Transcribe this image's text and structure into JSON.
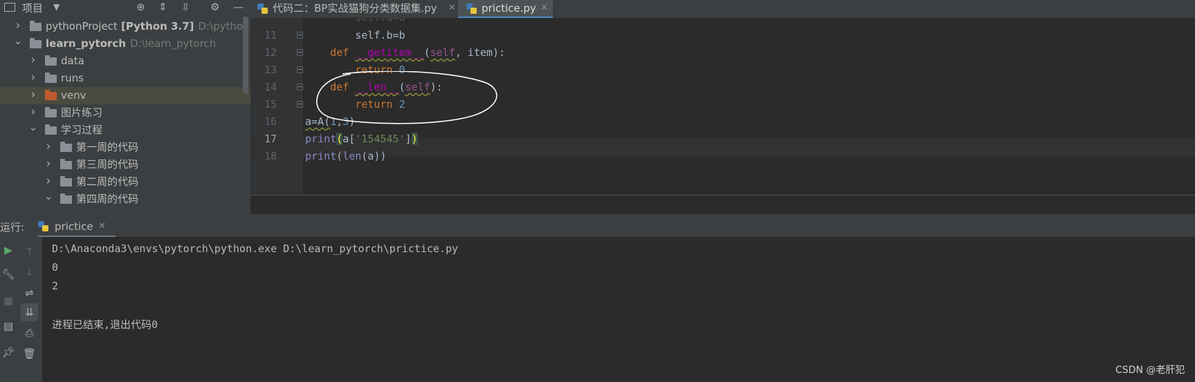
{
  "project_panel": {
    "title": "项目",
    "tree": [
      {
        "label": "pythonProject",
        "suffix": "[Python 3.7]",
        "path": "D:\\pythonProje",
        "depth": 0,
        "expanded": false,
        "bold": false
      },
      {
        "label": "learn_pytorch",
        "suffix": "",
        "path": "D:\\learn_pytorch",
        "depth": 0,
        "expanded": true,
        "bold": true
      },
      {
        "label": "data",
        "suffix": "",
        "path": "",
        "depth": 1,
        "expanded": false,
        "bold": false
      },
      {
        "label": "runs",
        "suffix": "",
        "path": "",
        "depth": 1,
        "expanded": false,
        "bold": false
      },
      {
        "label": "venv",
        "suffix": "",
        "path": "",
        "depth": 1,
        "expanded": false,
        "bold": false,
        "selected": true,
        "color": "orange"
      },
      {
        "label": "图片练习",
        "suffix": "",
        "path": "",
        "depth": 1,
        "expanded": false,
        "bold": false
      },
      {
        "label": "学习过程",
        "suffix": "",
        "path": "",
        "depth": 1,
        "expanded": true,
        "bold": false
      },
      {
        "label": "第一周的代码",
        "suffix": "",
        "path": "",
        "depth": 2,
        "expanded": false,
        "bold": false
      },
      {
        "label": "第三周的代码",
        "suffix": "",
        "path": "",
        "depth": 2,
        "expanded": false,
        "bold": false
      },
      {
        "label": "第二周的代码",
        "suffix": "",
        "path": "",
        "depth": 2,
        "expanded": false,
        "bold": false
      },
      {
        "label": "第四周的代码",
        "suffix": "",
        "path": "",
        "depth": 2,
        "expanded": true,
        "bold": false
      }
    ]
  },
  "editor": {
    "tabs": [
      {
        "label": "代码二：BP实战猫狗分类数据集.py",
        "active": false
      },
      {
        "label": "prictice.py",
        "active": true
      }
    ],
    "lines": [
      {
        "num": "11",
        "tokens": [
          [
            "plain",
            "        self.b"
          ],
          [
            "plain",
            "="
          ],
          [
            "plain",
            "b"
          ]
        ]
      },
      {
        "num": "12",
        "tokens": [
          [
            "plain",
            "    "
          ],
          [
            "kw",
            "def "
          ],
          [
            "fn-magic",
            "__getitem__"
          ],
          [
            "plain",
            "("
          ],
          [
            "self",
            "self"
          ],
          [
            "plain",
            ", item):"
          ]
        ]
      },
      {
        "num": "13",
        "tokens": [
          [
            "plain",
            "        "
          ],
          [
            "kw",
            "return "
          ],
          [
            "num",
            "0"
          ]
        ]
      },
      {
        "num": "14",
        "tokens": [
          [
            "plain",
            "    "
          ],
          [
            "kw",
            "def "
          ],
          [
            "fn-magic",
            "__len__"
          ],
          [
            "plain",
            "("
          ],
          [
            "self",
            "self"
          ],
          [
            "plain",
            "):"
          ]
        ]
      },
      {
        "num": "15",
        "tokens": [
          [
            "plain",
            "        "
          ],
          [
            "kw",
            "return "
          ],
          [
            "num",
            "2"
          ]
        ]
      },
      {
        "num": "16",
        "tokens": [
          [
            "plain",
            "a=A("
          ],
          [
            "num",
            "1"
          ],
          [
            "plain",
            ","
          ],
          [
            "num",
            "3"
          ],
          [
            "plain",
            ")"
          ]
        ]
      },
      {
        "num": "17",
        "tokens": [
          [
            "builtin",
            "print"
          ],
          [
            "brace",
            "("
          ],
          [
            "plain",
            "a["
          ],
          [
            "str",
            "'154545'"
          ],
          [
            "plain",
            "]"
          ],
          [
            "brace",
            ")"
          ]
        ]
      },
      {
        "num": "18",
        "tokens": [
          [
            "builtin",
            "print"
          ],
          [
            "plain",
            "("
          ],
          [
            "builtin",
            "len"
          ],
          [
            "plain",
            "(a))"
          ]
        ]
      }
    ],
    "warning_count": "7"
  },
  "run_panel": {
    "label": "运行:",
    "tab_label": "prictice",
    "console": [
      "D:\\Anaconda3\\envs\\pytorch\\python.exe D:\\learn_pytorch\\prictice.py",
      "0",
      "2",
      "",
      "进程已结束,退出代码0"
    ]
  },
  "watermark": "CSDN @老肝犯"
}
